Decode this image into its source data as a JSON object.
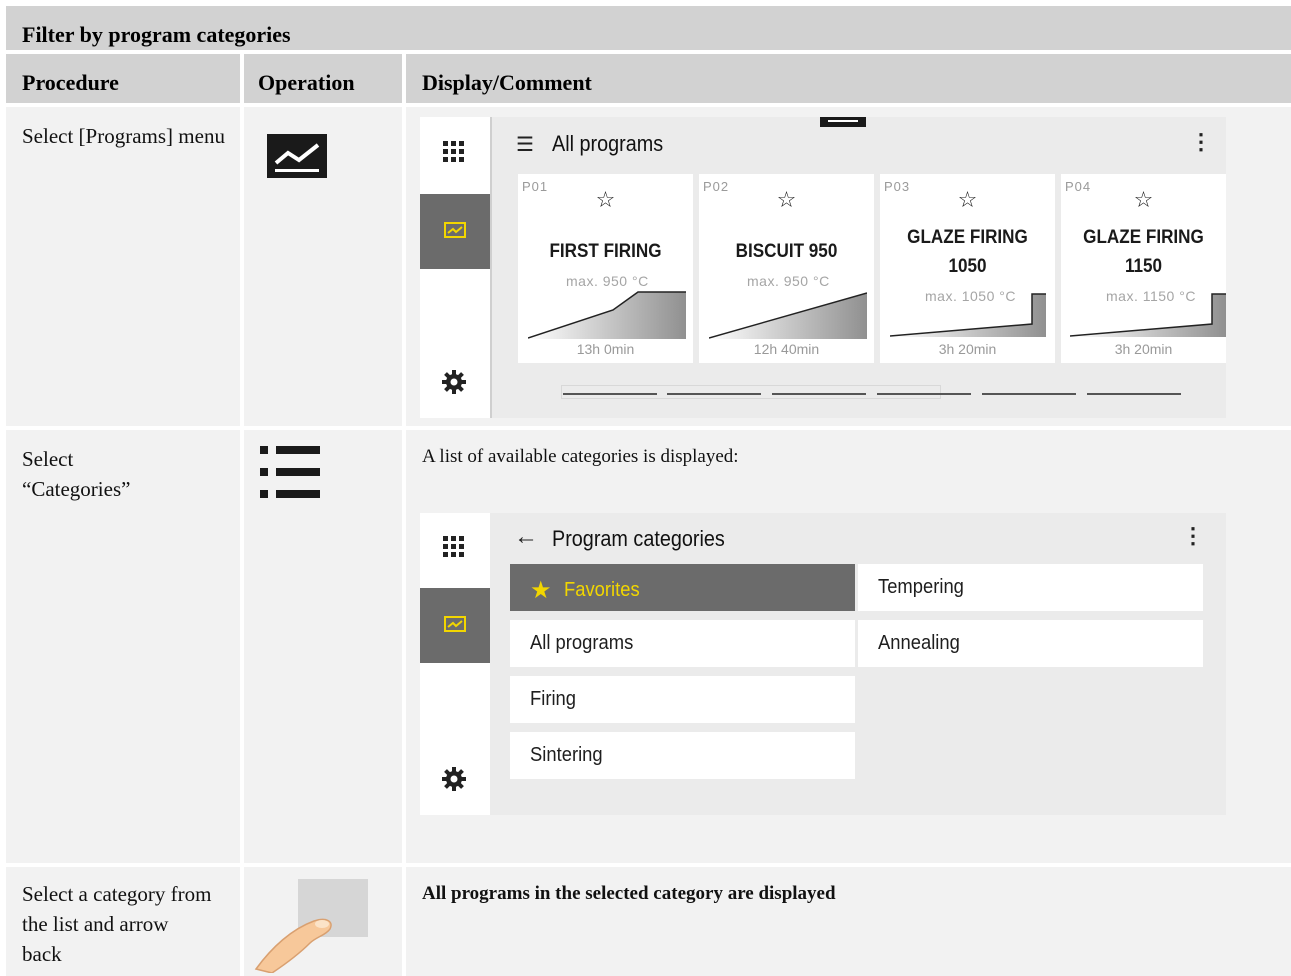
{
  "table": {
    "title": "Filter by program categories",
    "columns": [
      "Procedure",
      "Operation",
      "Display/Comment"
    ],
    "rows": [
      {
        "procedure": "Select [Programs] menu",
        "operation_icon": "programs-chart-icon"
      },
      {
        "procedure": "Select “Categories”",
        "operation_icon": "list-icon",
        "comment": "A list of available categories is displayed:"
      },
      {
        "procedure": "Select a category from the list and arrow back",
        "operation_icon": "finger-touch-icon",
        "comment": "All programs in the selected category are displayed"
      }
    ]
  },
  "screen1": {
    "title": "All programs",
    "programs": [
      {
        "id": "P01",
        "name_line1": "FIRST FIRING",
        "name_line2": "",
        "max": "max. 950 °C",
        "duration": "13h 0min"
      },
      {
        "id": "P02",
        "name_line1": "BISCUIT 950",
        "name_line2": "",
        "max": "max. 950 °C",
        "duration": "12h 40min"
      },
      {
        "id": "P03",
        "name_line1": "GLAZE FIRING",
        "name_line2": "1050",
        "max": "max. 1050 °C",
        "duration": "3h 20min"
      },
      {
        "id": "P04",
        "name_line1": "GLAZE FIRING",
        "name_line2": "1150",
        "max": "max. 1150 °C",
        "duration": "3h 20min"
      }
    ]
  },
  "screen2": {
    "title": "Program categories",
    "categories": [
      {
        "label": "Favorites",
        "selected": true
      },
      {
        "label": "Tempering"
      },
      {
        "label": "All programs"
      },
      {
        "label": "Annealing"
      },
      {
        "label": "Firing"
      },
      {
        "label": "Sintering"
      }
    ]
  },
  "colors": {
    "accent_yellow": "#f2d600",
    "rail_selected": "#6b6b6b",
    "header_bg": "#d2d2d2",
    "cell_bg": "#f2f2f2"
  }
}
